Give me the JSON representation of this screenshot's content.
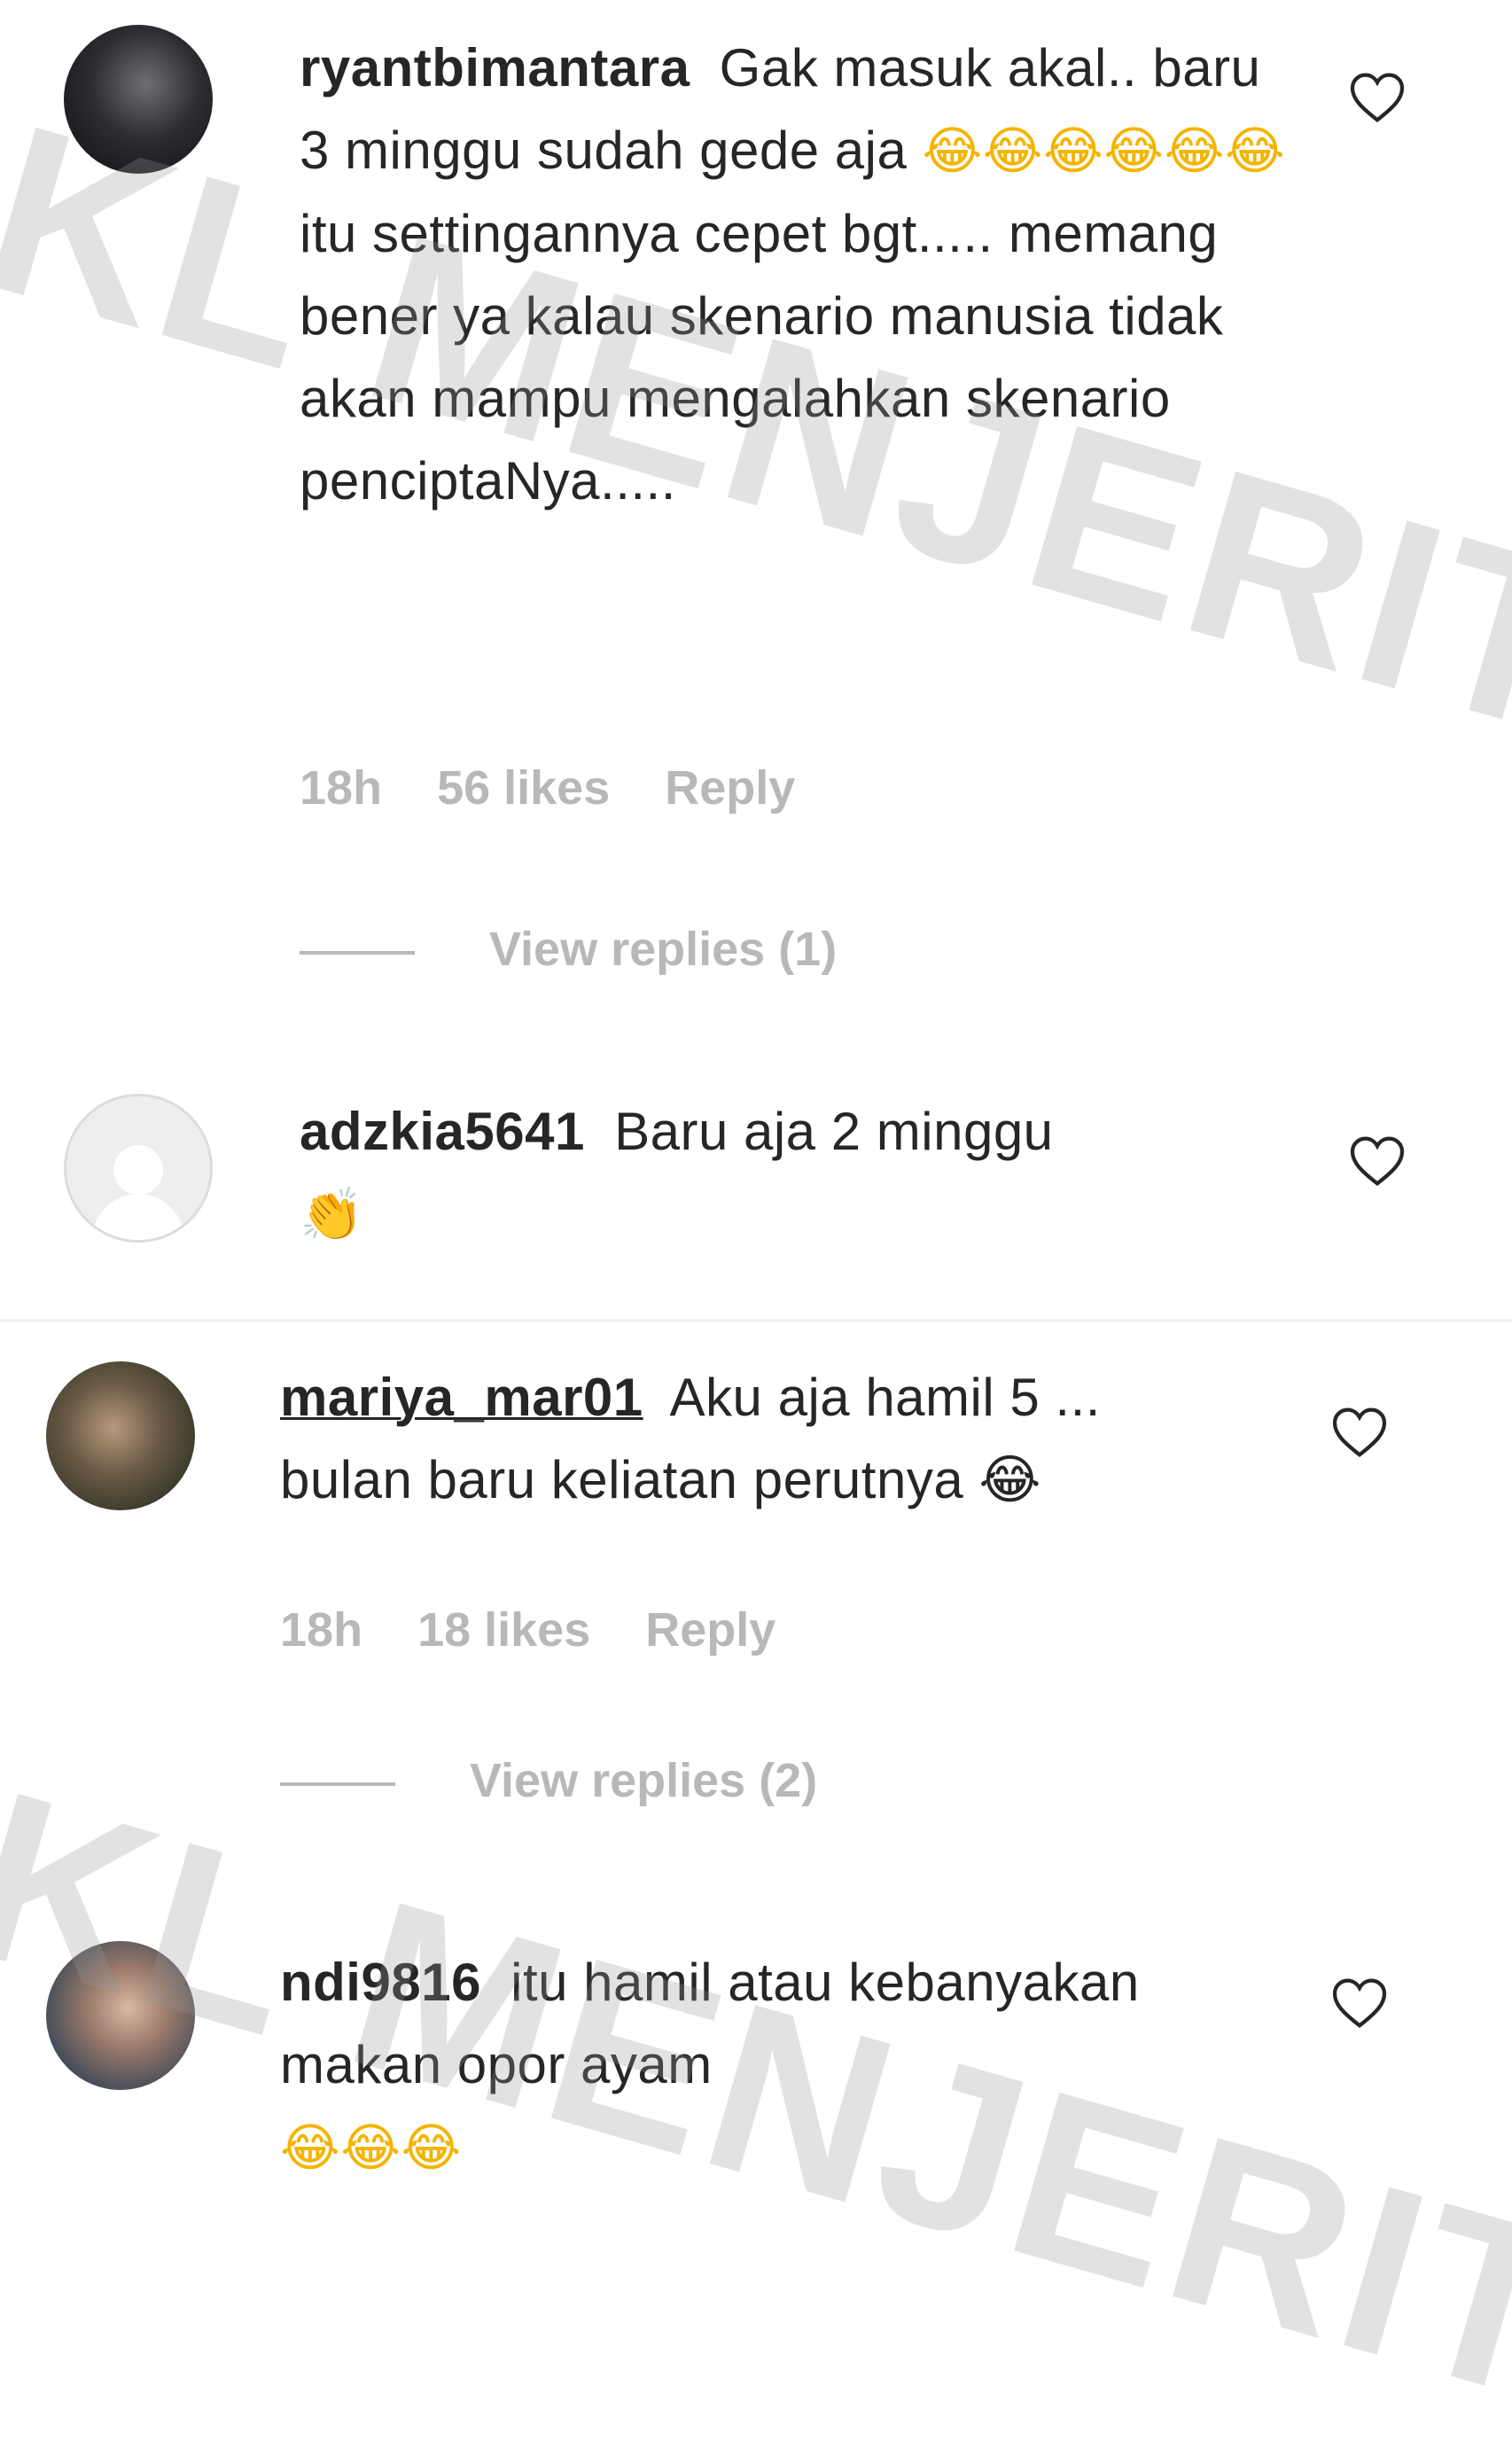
{
  "comments": [
    {
      "username": "ryantbimantara",
      "text": "Gak masuk akal.. baru 3 minggu sudah gede aja",
      "emojis": "😂😂😂😂😂😂",
      "text_after": "itu settingannya cepet bgt..... memang bener ya kalau skenario manusia tidak akan mampu mengalahkan skenario penciptaNya.....",
      "time": "18h",
      "likes": "56 likes",
      "reply": "Reply",
      "view_replies": "View replies (1)"
    },
    {
      "username": "adzkia5641",
      "text": "Baru aja 2 minggu",
      "emojis": "👏"
    },
    {
      "username": "mariya_mar01",
      "text": "Aku aja hamil 5 ...",
      "text_line2": "bulan baru keliatan perutnya 😂",
      "time": "18h",
      "likes": "18 likes",
      "reply": "Reply",
      "view_replies": "View replies (2)"
    },
    {
      "username": "ndi9816",
      "text": "itu hamil atau kebanyakan makan opor ayam",
      "emojis": "😂😂😂"
    }
  ],
  "watermark": "KL MENJERIT",
  "colors": {
    "text": "#262626",
    "meta": "#b8b8b8",
    "heart": "#262626",
    "emoji": "#f4b400"
  }
}
